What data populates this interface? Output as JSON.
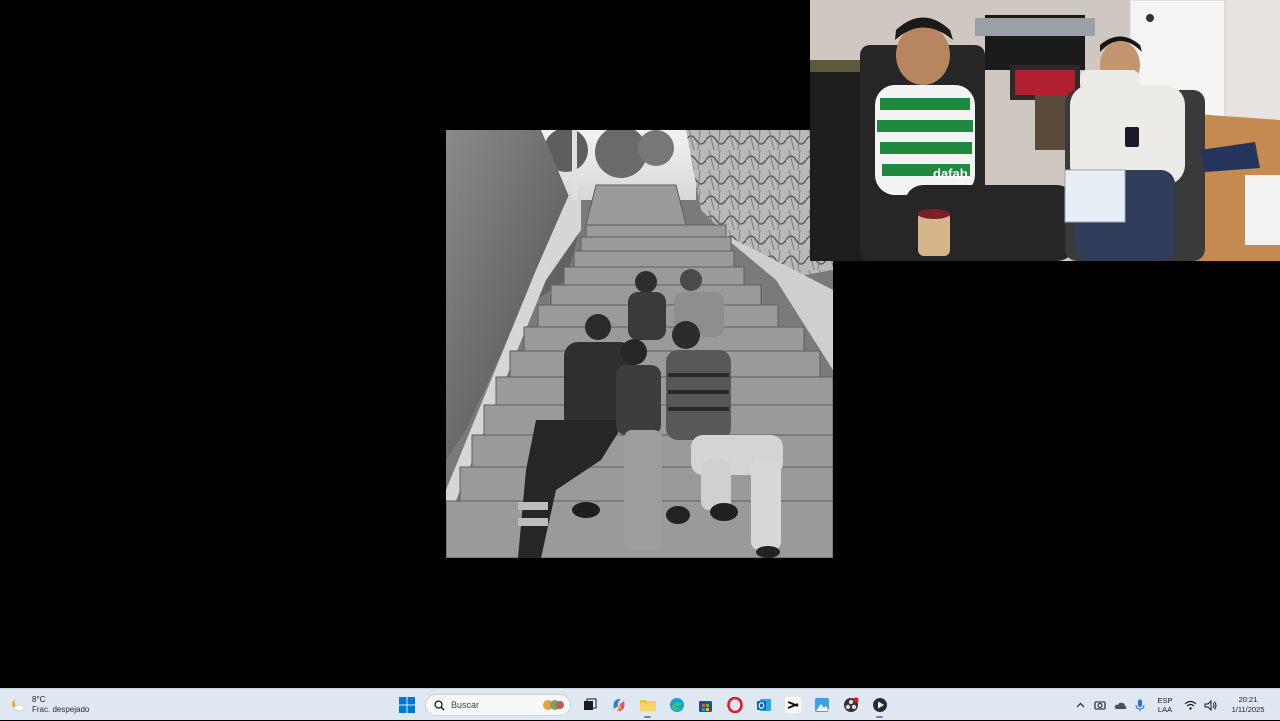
{
  "weather": {
    "temperature": "8°C",
    "condition": "Frac. despejado"
  },
  "search": {
    "placeholder": "Buscar"
  },
  "taskbar": {
    "apps": [
      {
        "name": "start",
        "icon": "windows-logo-icon"
      },
      {
        "name": "task-view",
        "icon": "task-view-icon"
      },
      {
        "name": "copilot",
        "icon": "copilot-icon"
      },
      {
        "name": "file-explorer",
        "icon": "folder-icon"
      },
      {
        "name": "edge",
        "icon": "edge-icon"
      },
      {
        "name": "store",
        "icon": "store-icon"
      },
      {
        "name": "opera",
        "icon": "opera-icon"
      },
      {
        "name": "outlook",
        "icon": "outlook-icon"
      },
      {
        "name": "capcut",
        "icon": "capcut-icon"
      },
      {
        "name": "photos",
        "icon": "photos-icon"
      },
      {
        "name": "obs",
        "icon": "obs-icon"
      },
      {
        "name": "media-player",
        "icon": "media-player-icon"
      }
    ]
  },
  "tray": {
    "lang_line1": "ESP",
    "lang_line2": "LAA",
    "time": "20:21",
    "date": "1/11/2025"
  },
  "colors": {
    "taskbar_bg": "#dfe7f0",
    "desktop_bg": "#000000",
    "windows_blue": "#0078d4"
  }
}
